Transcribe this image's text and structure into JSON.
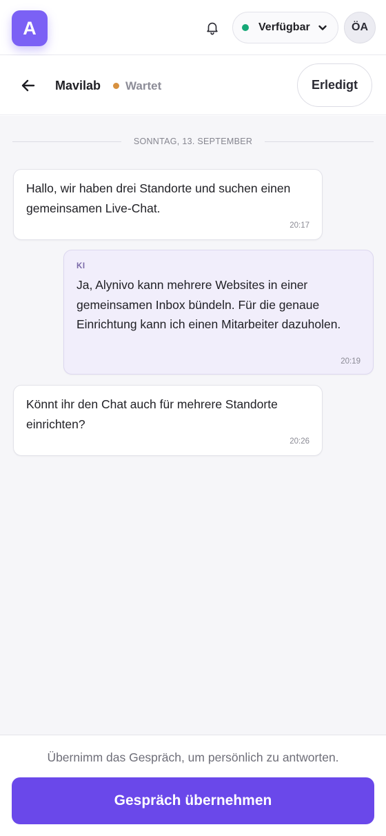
{
  "app": {
    "logo_letter": "A",
    "status": {
      "label": "Verfügbar",
      "color": "#16a877"
    },
    "avatar_initials": "ÖA"
  },
  "conversation": {
    "contact_name": "Mavilab",
    "state_label": "Wartet",
    "state_color": "#d7913f",
    "done_label": "Erledigt"
  },
  "thread": {
    "date_separator": "SONNTAG, 13. SEPTEMBER",
    "messages": [
      {
        "sender": "",
        "text": "Hallo, wir haben drei Standorte und suchen einen gemeinsamen Live-Chat.",
        "time": "20:17"
      },
      {
        "sender": "KI",
        "text": "Ja, Alynivo kann mehrere Websites in einer gemeinsamen Inbox bündeln. Für die genaue Einrichtung kann ich einen Mitarbeiter dazuholen.",
        "time": "20:19"
      },
      {
        "sender": "",
        "text": "Könnt ihr den Chat auch für mehrere Standorte einrichten?",
        "time": "20:26"
      }
    ]
  },
  "footer": {
    "hint": "Übernimm das Gespräch, um persönlich zu antworten.",
    "takeover_label": "Gespräch übernehmen"
  },
  "colors": {
    "accent": "#6a48ea",
    "logo": "#7b61f5",
    "ai_bubble": "#f1eefb"
  },
  "icons": [
    "bell-icon",
    "chevron-down-icon",
    "back-arrow-icon"
  ]
}
